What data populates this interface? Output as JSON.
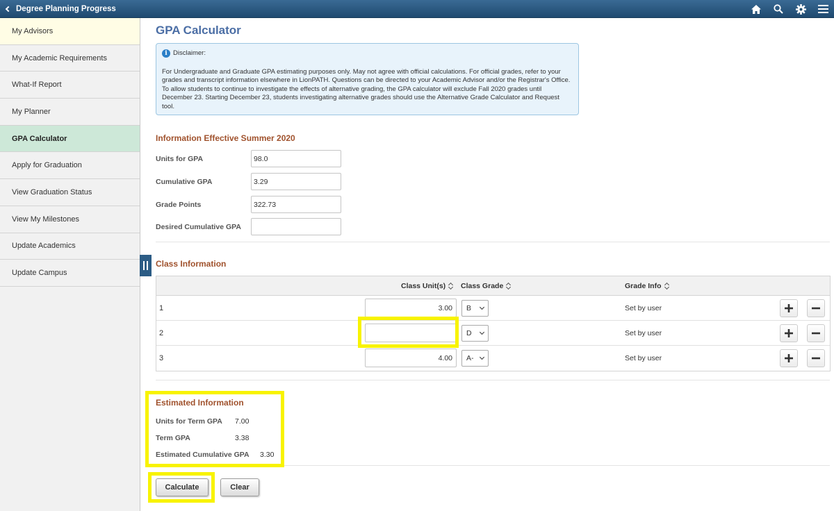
{
  "header": {
    "back_label": "Degree Planning Progress",
    "icons": [
      "home-icon",
      "search-icon",
      "gear-icon",
      "menu-icon"
    ]
  },
  "sidebar": {
    "items": [
      {
        "label": "My Advisors",
        "state": "hover"
      },
      {
        "label": "My Academic Requirements",
        "state": ""
      },
      {
        "label": "What-If Report",
        "state": ""
      },
      {
        "label": "My Planner",
        "state": ""
      },
      {
        "label": "GPA Calculator",
        "state": "active"
      },
      {
        "label": "Apply for Graduation",
        "state": ""
      },
      {
        "label": "View Graduation Status",
        "state": ""
      },
      {
        "label": "View My Milestones",
        "state": ""
      },
      {
        "label": "Update Academics",
        "state": ""
      },
      {
        "label": "Update Campus",
        "state": ""
      }
    ]
  },
  "page": {
    "title": "GPA Calculator"
  },
  "disclaimer": {
    "heading": "Disclaimer:",
    "body": "For Undergraduate and Graduate GPA estimating purposes only. May not agree with official calculations. For official grades, refer to your grades and transcript information elsewhere in LionPATH. Questions can be directed to your Academic Advisor and/or the Registrar's Office. To allow students to continue to investigate the effects of alternative grading, the GPA calculator will exclude Fall 2020 grades until December 23. Starting December 23, students investigating alternative grades should use the Alternative Grade Calculator and Request tool."
  },
  "effective": {
    "title": "Information Effective Summer 2020",
    "fields": [
      {
        "label": "Units for GPA",
        "value": "98.0"
      },
      {
        "label": "Cumulative GPA",
        "value": "3.29"
      },
      {
        "label": "Grade Points",
        "value": "322.73"
      },
      {
        "label": "Desired Cumulative GPA",
        "value": ""
      }
    ]
  },
  "classes": {
    "title": "Class Information",
    "headers": {
      "units": "Class Unit(s)",
      "grade": "Class Grade",
      "info": "Grade Info"
    },
    "rows": [
      {
        "num": "1",
        "units": "3.00",
        "grade": "B",
        "info": "Set by user"
      },
      {
        "num": "2",
        "units": "",
        "grade": "D",
        "info": "Set by user"
      },
      {
        "num": "3",
        "units": "4.00",
        "grade": "A-",
        "info": "Set by user"
      }
    ]
  },
  "estimated": {
    "title": "Estimated Information",
    "units_label": "Units for Term GPA",
    "units_value": "7.00",
    "term_label": "Term GPA",
    "term_value": "3.38",
    "cum_label": "Estimated Cumulative GPA",
    "cum_value": "3.30"
  },
  "actions": {
    "calculate": "Calculate",
    "clear": "Clear"
  },
  "colors": {
    "accent_title": "#4b6ea5",
    "section_title": "#a0522d",
    "topbar": "#2a5a82",
    "active_nav": "#cde8d8",
    "highlight": "#f8f300"
  }
}
